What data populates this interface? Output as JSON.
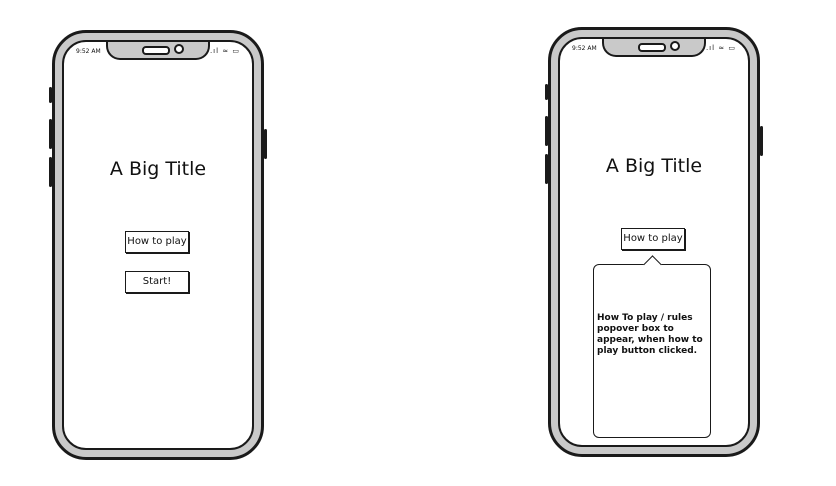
{
  "screen_left": {
    "status": {
      "time": "9:52 AM",
      "icons": ".ıl ≈ ▭"
    },
    "title": "A Big Title",
    "how_to_play_label": "How to play",
    "start_label": "Start!"
  },
  "screen_right": {
    "status": {
      "time": "9:52 AM",
      "icons": ".ıl ≈ ▭"
    },
    "title": "A Big Title",
    "how_to_play_label": "How to play",
    "popover_text": "How To play / rules popover box to appear, when how to play button clicked."
  }
}
